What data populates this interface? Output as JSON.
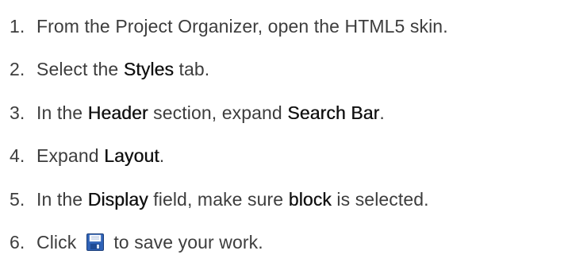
{
  "steps": [
    {
      "number": "1.",
      "before": "From the Project Organizer, open the HTML5 skin."
    },
    {
      "number": "2.",
      "before": "Select the ",
      "ui": "Styles",
      "after": " tab."
    },
    {
      "number": "3.",
      "before": "In the ",
      "ui": "Header",
      "middle": " section, expand ",
      "ui2": "Search Bar",
      "after": "."
    },
    {
      "number": "4.",
      "before": "Expand ",
      "ui": "Layout",
      "after": "."
    },
    {
      "number": "5.",
      "before": "In the ",
      "ui": "Display",
      "middle": " field, make sure ",
      "ui2": "block",
      "after": " is selected."
    },
    {
      "number": "6.",
      "before": "Click ",
      "icon": "save-icon",
      "after": " to save your work."
    }
  ],
  "colors": {
    "text": "#3d3d3d",
    "ui_text": "#111111",
    "save_icon_blue": "#2f63b8"
  }
}
